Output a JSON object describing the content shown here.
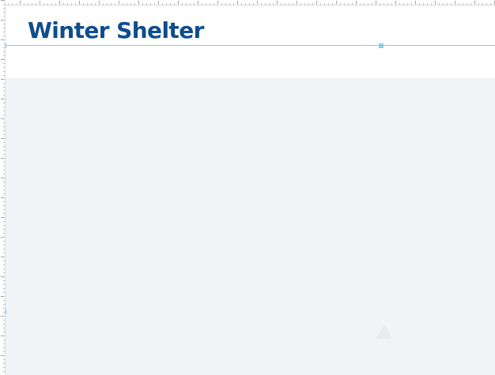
{
  "page": {
    "title": "Winter Shelter"
  },
  "colors": {
    "title_color": "#0f4d8c",
    "guide_color": "#8ecae6",
    "content_background": "#f1f3f6"
  },
  "icons": {
    "placeholder_icon": "triangle-icon"
  }
}
